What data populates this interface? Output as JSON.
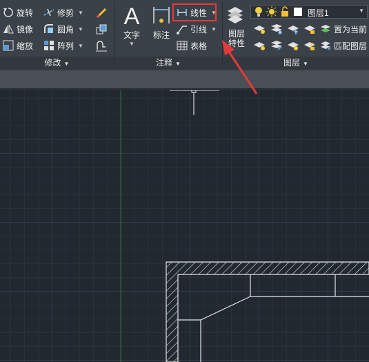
{
  "modify": {
    "rotate": "旋转",
    "trim": "修剪",
    "mirror": "镜像",
    "fillet": "圆角",
    "scale": "缩放",
    "array": "阵列",
    "title": "修改"
  },
  "annotation": {
    "text": "文字",
    "dimension": "标注",
    "linear": "线性",
    "leader": "引线",
    "table": "表格",
    "title": "注释"
  },
  "layers": {
    "layer_properties": "图层\n特性",
    "current_layer": "图层1",
    "set_current": "置为当前",
    "match_layer": "匹配图层",
    "title": "图层"
  },
  "colors": {
    "highlight": "#e53a3a",
    "canvas": "#212830",
    "ribbon": "#3b4148"
  }
}
